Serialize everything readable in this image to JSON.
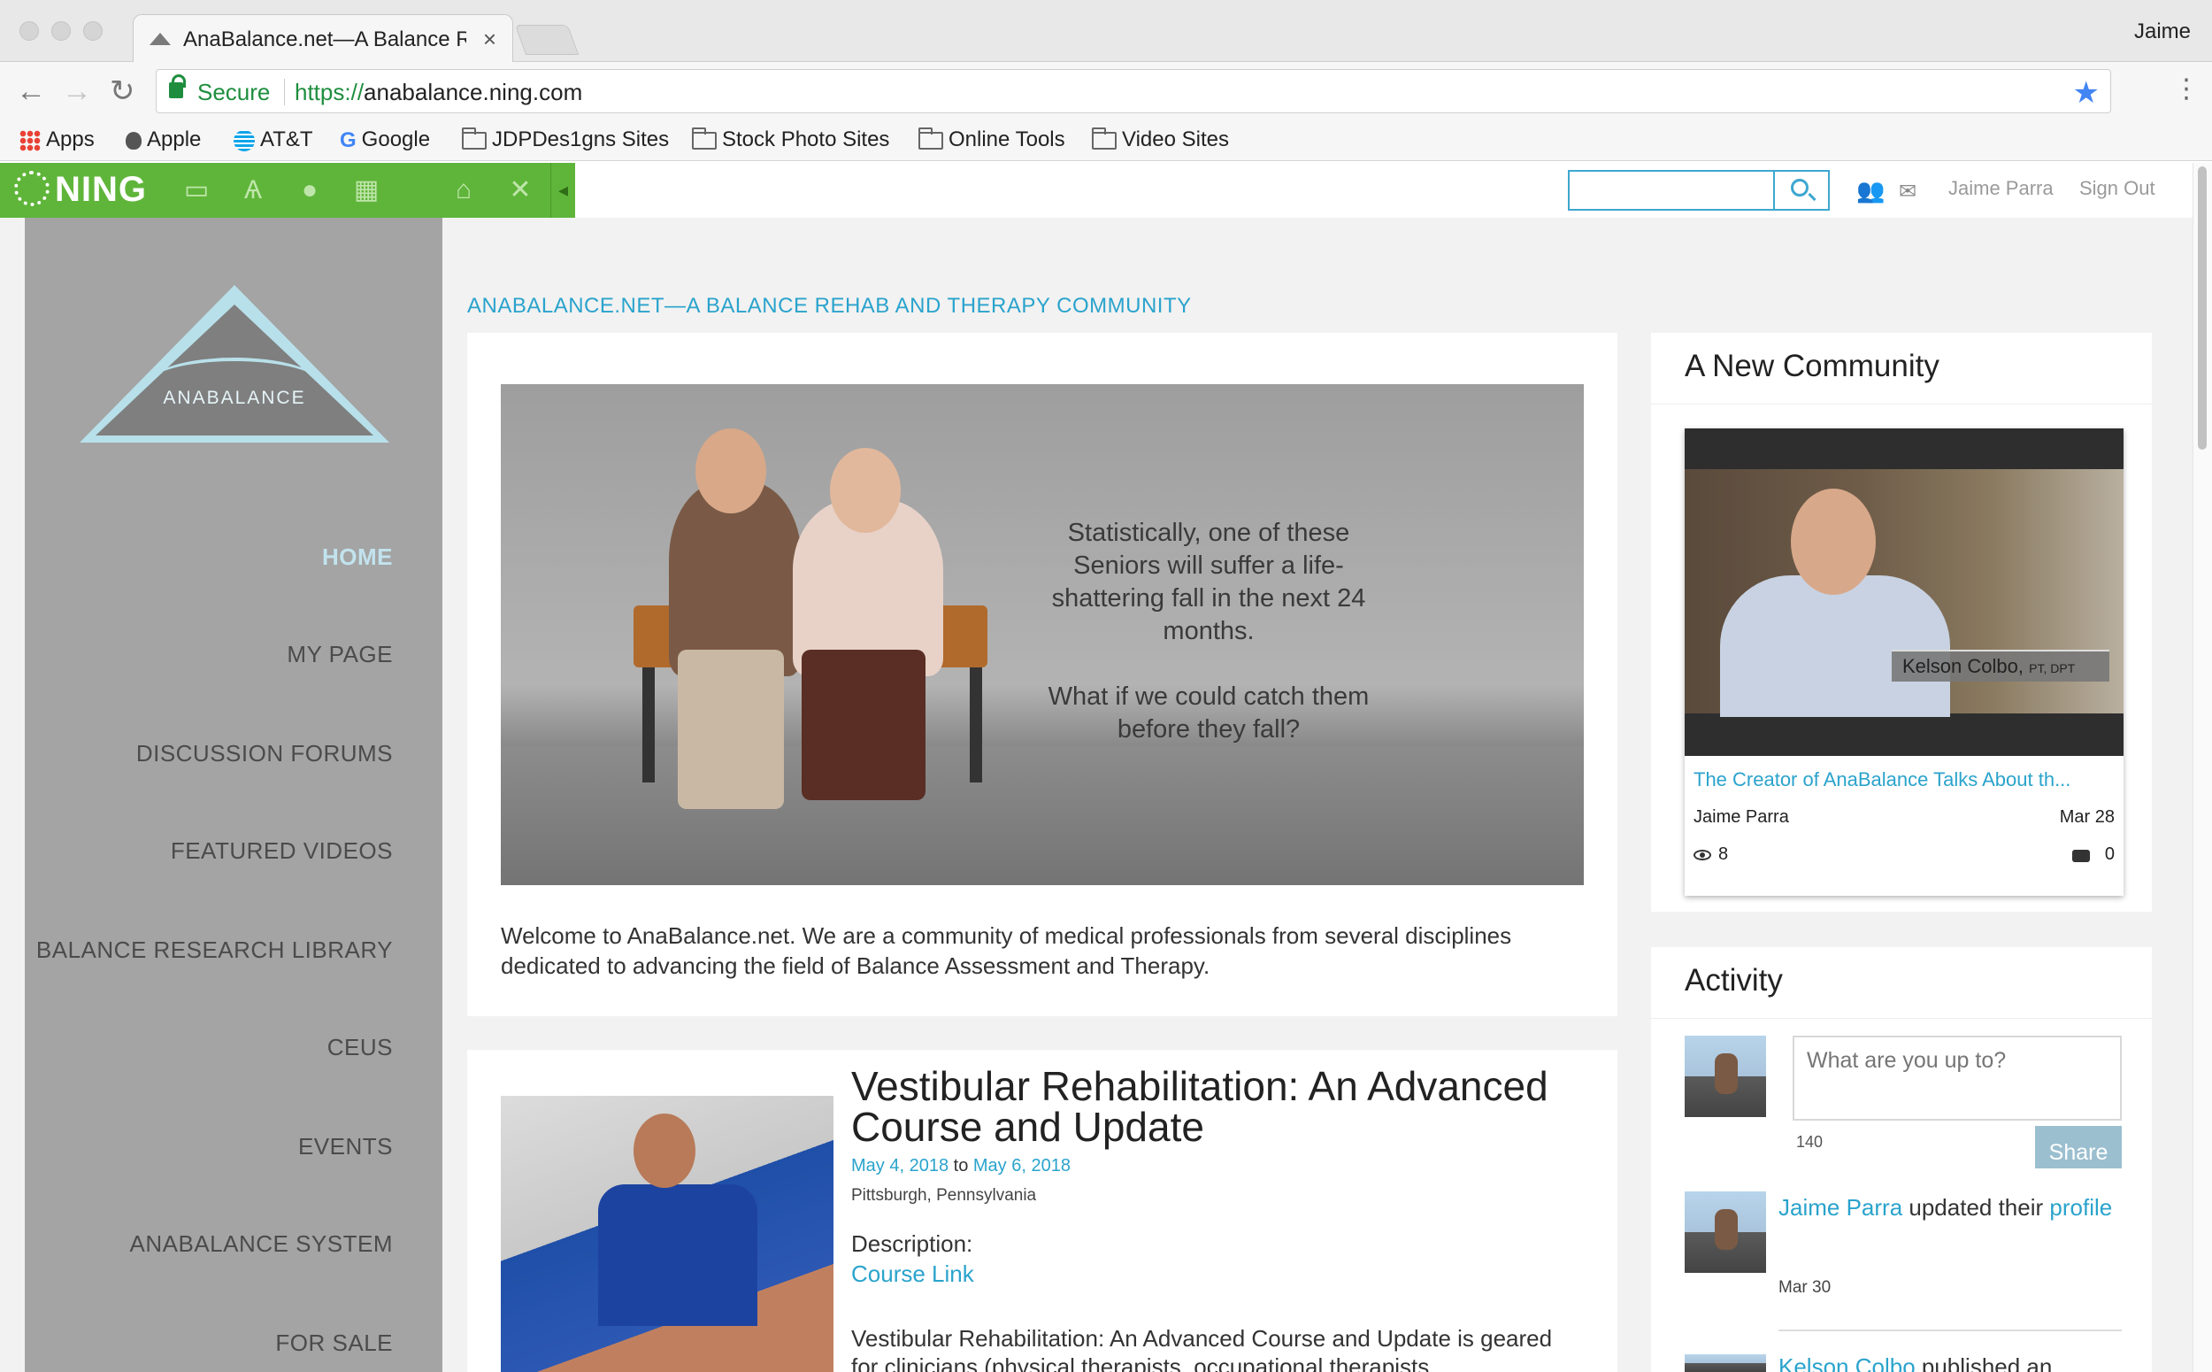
{
  "browser": {
    "tab_title": "AnaBalance.net—A Balance Re",
    "tab_close": "×",
    "user": "Jaime",
    "secure_label": "Secure",
    "url_scheme": "https://",
    "url_host": "anabalance.ning.com",
    "bookmarks": [
      {
        "label": "Apps",
        "icon": "apps-grid-icon"
      },
      {
        "label": "Apple",
        "icon": "apple-icon"
      },
      {
        "label": "AT&T",
        "icon": "att-icon"
      },
      {
        "label": "Google",
        "icon": "google-icon"
      },
      {
        "label": "JDPDes1gns Sites",
        "icon": "folder-icon"
      },
      {
        "label": "Stock Photo Sites",
        "icon": "folder-icon"
      },
      {
        "label": "Online Tools",
        "icon": "folder-icon"
      },
      {
        "label": "Video Sites",
        "icon": "folder-icon"
      }
    ]
  },
  "ning_bar": {
    "logo": "NING",
    "icons": [
      "screen-icon",
      "appearance-icon",
      "member-icon",
      "apps-icon",
      "home-icon",
      "tools-icon"
    ],
    "accent": "#5fb53a"
  },
  "topbar": {
    "search_placeholder": "",
    "user_name": "Jaime Parra",
    "sign_out": "Sign Out"
  },
  "sidebar": {
    "logo_text": "ANABALANCE",
    "nav": [
      {
        "label": "HOME",
        "active": true
      },
      {
        "label": "MY PAGE",
        "active": false
      },
      {
        "label": "DISCUSSION FORUMS",
        "active": false
      },
      {
        "label": "FEATURED VIDEOS",
        "active": false
      },
      {
        "label": "BALANCE RESEARCH LIBRARY",
        "active": false
      },
      {
        "label": "CEUS",
        "active": false
      },
      {
        "label": "EVENTS",
        "active": false
      },
      {
        "label": "ANABALANCE SYSTEM",
        "active": false
      },
      {
        "label": "FOR SALE",
        "active": false
      }
    ]
  },
  "main": {
    "site_title": "ANABALANCE.NET—A BALANCE REHAB AND THERAPY COMMUNITY",
    "hero_quote_line1": "Statistically, one of these Seniors will suffer a life-shattering fall in the next 24 months.",
    "hero_quote_line2": "What if we could catch them before they fall?",
    "welcome": "Welcome to AnaBalance.net. We are a community of medical professionals from several disciplines dedicated to advancing the field of Balance Assessment and Therapy.",
    "event": {
      "title": "Vestibular Rehabilitation: An Advanced Course and Update",
      "start": "May 4, 2018",
      "to": "to",
      "end": "May 6, 2018",
      "location": "Pittsburgh, Pennsylvania",
      "description_label": "Description:",
      "course_link": "Course Link",
      "body": "Vestibular Rehabilitation: An Advanced Course and Update is geared for clinicians (physical therapists, occupational therapists"
    }
  },
  "community": {
    "title": "A New Community",
    "video": {
      "lower_third_name": "Kelson Colbo,",
      "lower_third_cred": "PT, DPT",
      "title": "The Creator of AnaBalance Talks About th...",
      "author": "Jaime Parra",
      "date": "Mar 28",
      "views": "8",
      "comments": "0"
    }
  },
  "activity": {
    "title": "Activity",
    "status_placeholder": "What are you up to?",
    "char_count": "140",
    "share": "Share",
    "item1_user": "Jaime Parra",
    "item1_text": " updated their ",
    "item1_link": "profile",
    "item1_date": "Mar 30",
    "item2_user": "Kelson Colbo",
    "item2_text": " published an"
  },
  "colors": {
    "link": "#2aa3cc",
    "sidebar": "#a4a4a4",
    "active_nav": "#c2e3ee"
  }
}
